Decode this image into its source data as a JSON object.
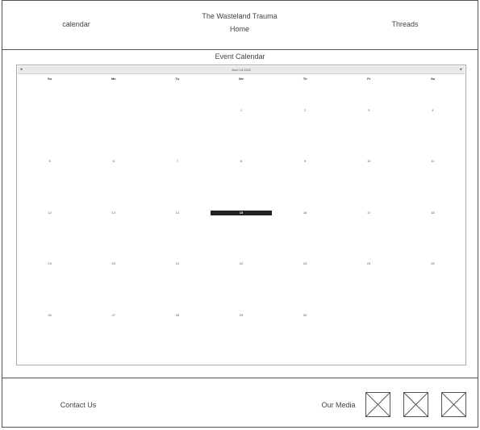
{
  "header": {
    "left_link": "calendar",
    "site_title": "The Wasteland Trauma",
    "home_link": "Home",
    "right_link": "Threads"
  },
  "main": {
    "section_title": "Event Calendar"
  },
  "calendar": {
    "prev_icon": "◂",
    "next_icon": "▸",
    "month_label": "June 15 2022",
    "weekdays": [
      "Su",
      "Mo",
      "Tu",
      "We",
      "Th",
      "Fr",
      "Sa"
    ],
    "days": [
      "",
      "",
      "",
      "1",
      "2",
      "3",
      "4",
      "5",
      "6",
      "7",
      "8",
      "9",
      "10",
      "11",
      "12",
      "13",
      "14",
      "15",
      "16",
      "17",
      "18",
      "19",
      "20",
      "21",
      "22",
      "23",
      "24",
      "25",
      "26",
      "27",
      "28",
      "29",
      "30",
      "",
      "",
      ""
    ],
    "today": "15"
  },
  "footer": {
    "contact_link": "Contact Us",
    "media_label": "Our Media",
    "media_icons": [
      "image-placeholder-icon",
      "image-placeholder-icon",
      "image-placeholder-icon"
    ]
  },
  "colors": {
    "border": "#555555",
    "today_bg": "#222222",
    "nav_bar_bg": "#e9e9e9"
  }
}
